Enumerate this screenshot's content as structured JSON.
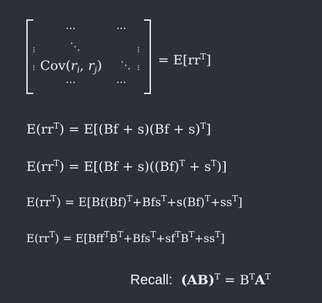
{
  "matrix": {
    "top_dots_1": "···",
    "top_dots_2": "···",
    "row2_vdots_left": "⁝",
    "row2_ddots": "⋱",
    "row2_vdots_right": "⁝",
    "row3_vdots_left": "⁝",
    "cov_func": "Cov",
    "cov_arg_r1": "r",
    "cov_sub_i": "i",
    "cov_sep": ",",
    "cov_arg_r2": "r",
    "cov_sub_j": "j",
    "row3_ddots": "⋱",
    "row3_vdots_right": "⁝",
    "bottom_dots_1": "···",
    "bottom_dots_2": "···",
    "rhs": "= E[rr",
    "rhs_sup": "T",
    "rhs_close": "]"
  },
  "equations": [
    {
      "lhs": "E(rr",
      "lhs_sup": "T",
      "lhs_close": ") = E[(Bf + s)(Bf + s)",
      "rhs_sup": "T",
      "rhs_close": "]"
    },
    {
      "lhs": "E(rr",
      "lhs_sup": "T",
      "lhs_close": ") = E[(Bf + s)((Bf)",
      "sup_a": "T",
      "mid": " + s",
      "sup_b": "T",
      "end": ")]"
    },
    {
      "lhs": "E(rr",
      "lhs_sup": "T",
      "lhs_close": ") = E[Bf(Bf)",
      "sup_a": "T",
      "mid_a": "+Bfs",
      "sup_b": "T",
      "mid_b": "+s(Bf)",
      "sup_c": "T",
      "mid_c": "+ss",
      "sup_d": "T",
      "end": "]"
    },
    {
      "lhs": "E(rr",
      "lhs_sup": "T",
      "lhs_close": ") = E[Bff",
      "sup_a": "T",
      "mid_a": "B",
      "sup_b": "T",
      "mid_b": "+Bfs",
      "sup_c": "T",
      "mid_c": "+sf",
      "sup_d": "T",
      "mid_d": "B",
      "sup_e": "T",
      "mid_e": "+ss",
      "sup_f": "T",
      "end": "]"
    }
  ],
  "recall": {
    "label": "Recall:",
    "expr_a": "(AB)",
    "sup_a": "T",
    "eq": " = B",
    "sup_b": "T",
    "expr_c": "A",
    "sup_c": "T"
  }
}
